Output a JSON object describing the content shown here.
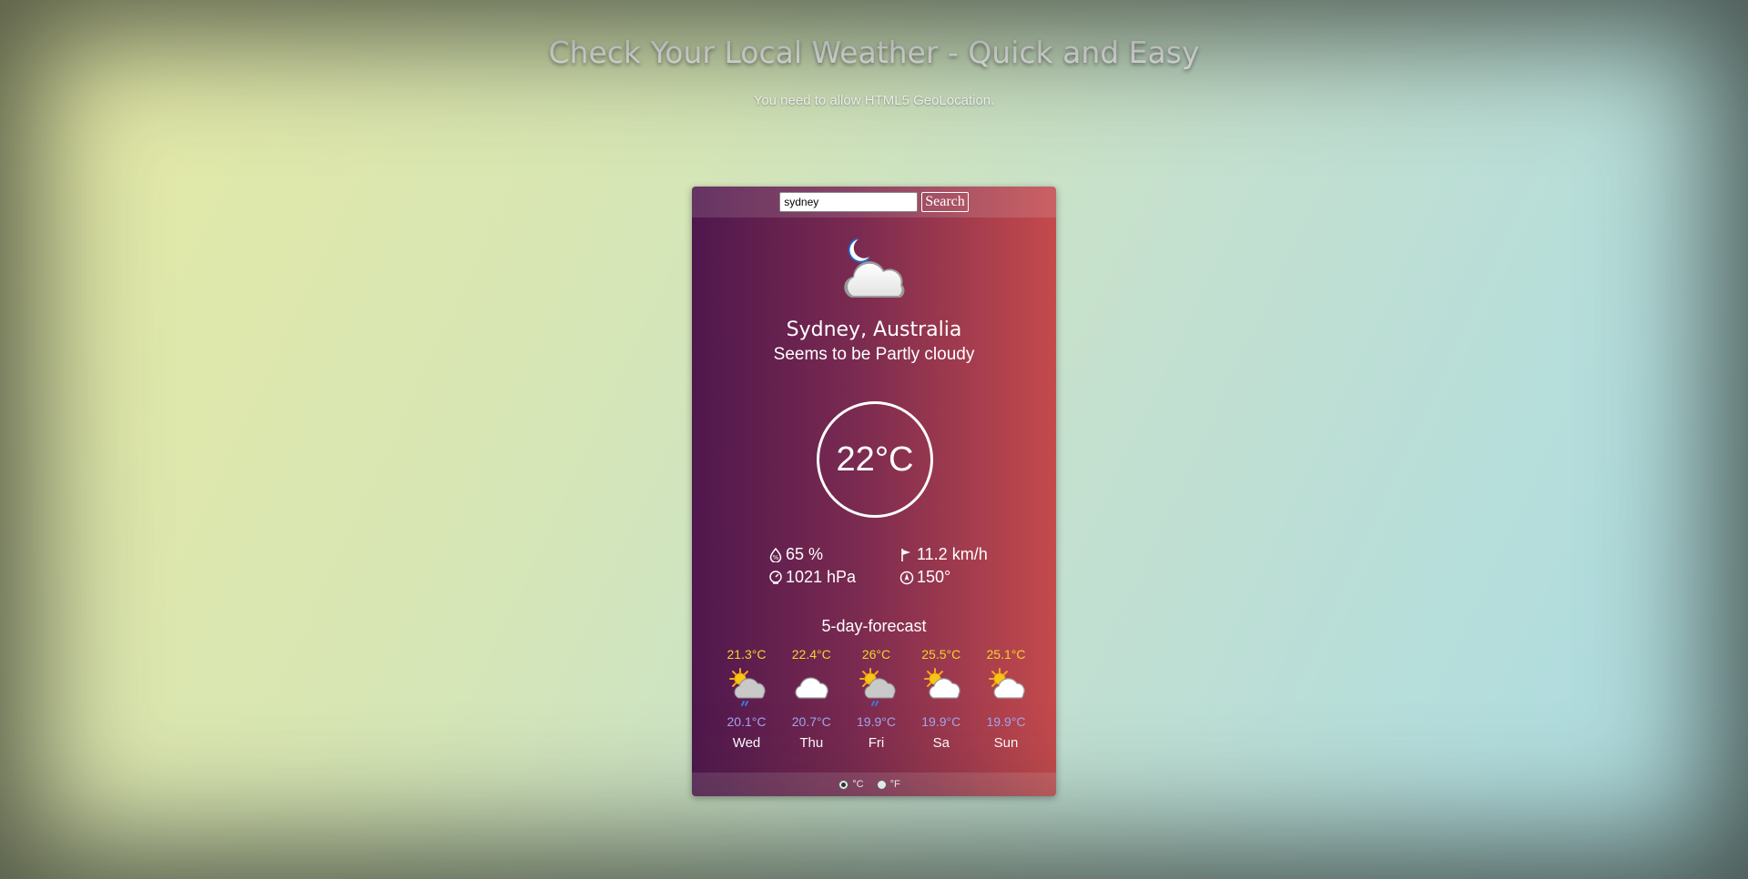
{
  "header": {
    "title": "Check Your Local Weather - Quick and Easy",
    "subtitle": "You need to allow HTML5 GeoLocation."
  },
  "search": {
    "value": "sydney",
    "button_label": "Search"
  },
  "current": {
    "icon": "night-partly-cloudy-icon",
    "city": "Sydney, Australia",
    "condition": "Seems to be Partly cloudy",
    "temperature": "22°C",
    "humidity": "65 %",
    "wind_speed": "11.2 km/h",
    "pressure": "1021 hPa",
    "wind_direction": "150°"
  },
  "forecast": {
    "title": "5-day-forecast",
    "days": [
      {
        "name": "Wed",
        "high": "21.3°C",
        "low": "20.1°C",
        "icon": "sun-cloud-rain-icon"
      },
      {
        "name": "Thu",
        "high": "22.4°C",
        "low": "20.7°C",
        "icon": "cloud-icon"
      },
      {
        "name": "Fri",
        "high": "26°C",
        "low": "19.9°C",
        "icon": "sun-cloud-rain-icon"
      },
      {
        "name": "Sa",
        "high": "25.5°C",
        "low": "19.9°C",
        "icon": "sun-cloud-icon"
      },
      {
        "name": "Sun",
        "high": "25.1°C",
        "low": "19.9°C",
        "icon": "sun-cloud-icon"
      }
    ]
  },
  "units": {
    "celsius_label": "°C",
    "fahrenheit_label": "°F",
    "selected": "celsius"
  },
  "colors": {
    "high_temp": "#f7d32a",
    "low_temp": "#a3a6ef",
    "card_left": "#4f174d",
    "card_right": "#c44a4c"
  }
}
